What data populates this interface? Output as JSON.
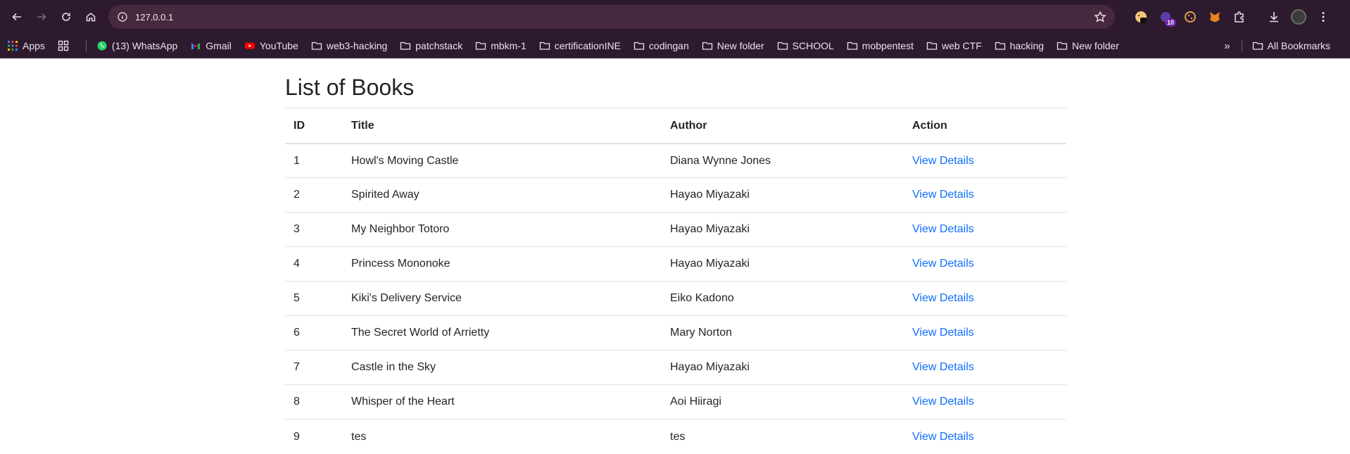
{
  "browser": {
    "url": "127.0.0.1",
    "extension_badge": "10",
    "bookmarks": [
      {
        "label": "Apps",
        "icon": "apps-grid-icon"
      },
      {
        "label": "(13) WhatsApp",
        "icon": "whatsapp-icon"
      },
      {
        "label": "Gmail",
        "icon": "gmail-icon"
      },
      {
        "label": "YouTube",
        "icon": "youtube-icon"
      },
      {
        "label": "web3-hacking",
        "icon": "folder-icon"
      },
      {
        "label": "patchstack",
        "icon": "folder-icon"
      },
      {
        "label": "mbkm-1",
        "icon": "folder-icon"
      },
      {
        "label": "certificationINE",
        "icon": "folder-icon"
      },
      {
        "label": "codingan",
        "icon": "folder-icon"
      },
      {
        "label": "New folder",
        "icon": "folder-icon"
      },
      {
        "label": "SCHOOL",
        "icon": "folder-icon"
      },
      {
        "label": "mobpentest",
        "icon": "folder-icon"
      },
      {
        "label": "web CTF",
        "icon": "folder-icon"
      },
      {
        "label": "hacking",
        "icon": "folder-icon"
      },
      {
        "label": "New folder",
        "icon": "folder-icon"
      }
    ],
    "more_label": "»",
    "all_bookmarks": "All Bookmarks"
  },
  "page": {
    "title": "List of Books",
    "columns": [
      "ID",
      "Title",
      "Author",
      "Action"
    ],
    "rows": [
      {
        "id": "1",
        "title": "Howl's Moving Castle",
        "author": "Diana Wynne Jones",
        "action": "View Details"
      },
      {
        "id": "2",
        "title": "Spirited Away",
        "author": "Hayao Miyazaki",
        "action": "View Details"
      },
      {
        "id": "3",
        "title": "My Neighbor Totoro",
        "author": "Hayao Miyazaki",
        "action": "View Details"
      },
      {
        "id": "4",
        "title": "Princess Mononoke",
        "author": "Hayao Miyazaki",
        "action": "View Details"
      },
      {
        "id": "5",
        "title": "Kiki's Delivery Service",
        "author": "Eiko Kadono",
        "action": "View Details"
      },
      {
        "id": "6",
        "title": "The Secret World of Arrietty",
        "author": "Mary Norton",
        "action": "View Details"
      },
      {
        "id": "7",
        "title": "Castle in the Sky",
        "author": "Hayao Miyazaki",
        "action": "View Details"
      },
      {
        "id": "8",
        "title": "Whisper of the Heart",
        "author": "Aoi Hiiragi",
        "action": "View Details"
      },
      {
        "id": "9",
        "title": "tes",
        "author": "tes",
        "action": "View Details"
      }
    ]
  },
  "colors": {
    "chrome_bg": "#2d1a2e",
    "omnibox_bg": "#47293f",
    "link": "#0d6efd",
    "text": "#212529"
  }
}
